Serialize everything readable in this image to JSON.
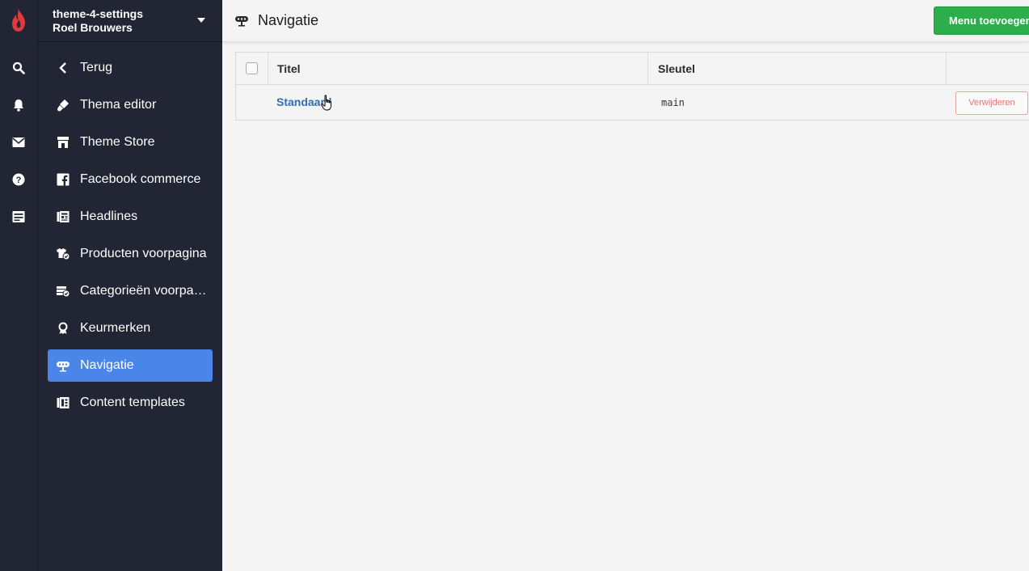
{
  "store": {
    "name": "theme-4-settings",
    "user": "Roel Brouwers"
  },
  "rail": {
    "icons": [
      "lightspeed-flame-logo",
      "search-icon",
      "bell-icon",
      "mail-icon",
      "help-icon",
      "storefront-icon"
    ]
  },
  "sidebar": {
    "items": [
      {
        "label": "Terug",
        "icon": "chevron-left-icon"
      },
      {
        "label": "Thema editor",
        "icon": "paintbrush-icon"
      },
      {
        "label": "Theme Store",
        "icon": "store-icon"
      },
      {
        "label": "Facebook commerce",
        "icon": "facebook-icon"
      },
      {
        "label": "Headlines",
        "icon": "newspaper-icon"
      },
      {
        "label": "Producten voorpagina",
        "icon": "products-front-icon"
      },
      {
        "label": "Categorieën voorpagina",
        "icon": "categories-front-icon"
      },
      {
        "label": "Keurmerken",
        "icon": "award-icon"
      },
      {
        "label": "Navigatie",
        "icon": "signpost-icon",
        "active": true
      },
      {
        "label": "Content templates",
        "icon": "template-icon"
      }
    ]
  },
  "header": {
    "title": "Navigatie",
    "add_button": "Menu toevoegen"
  },
  "table": {
    "columns": [
      "Titel",
      "Sleutel"
    ],
    "rows": [
      {
        "title": "Standaard",
        "key": "main",
        "delete_label": "Verwijderen"
      }
    ]
  },
  "colors": {
    "sidebar_bg": "#222634",
    "active_item": "#4a86e8",
    "primary_button": "#2ead4b",
    "link": "#2d6fbd",
    "danger": "#e07777",
    "brand": "#e0393e"
  }
}
